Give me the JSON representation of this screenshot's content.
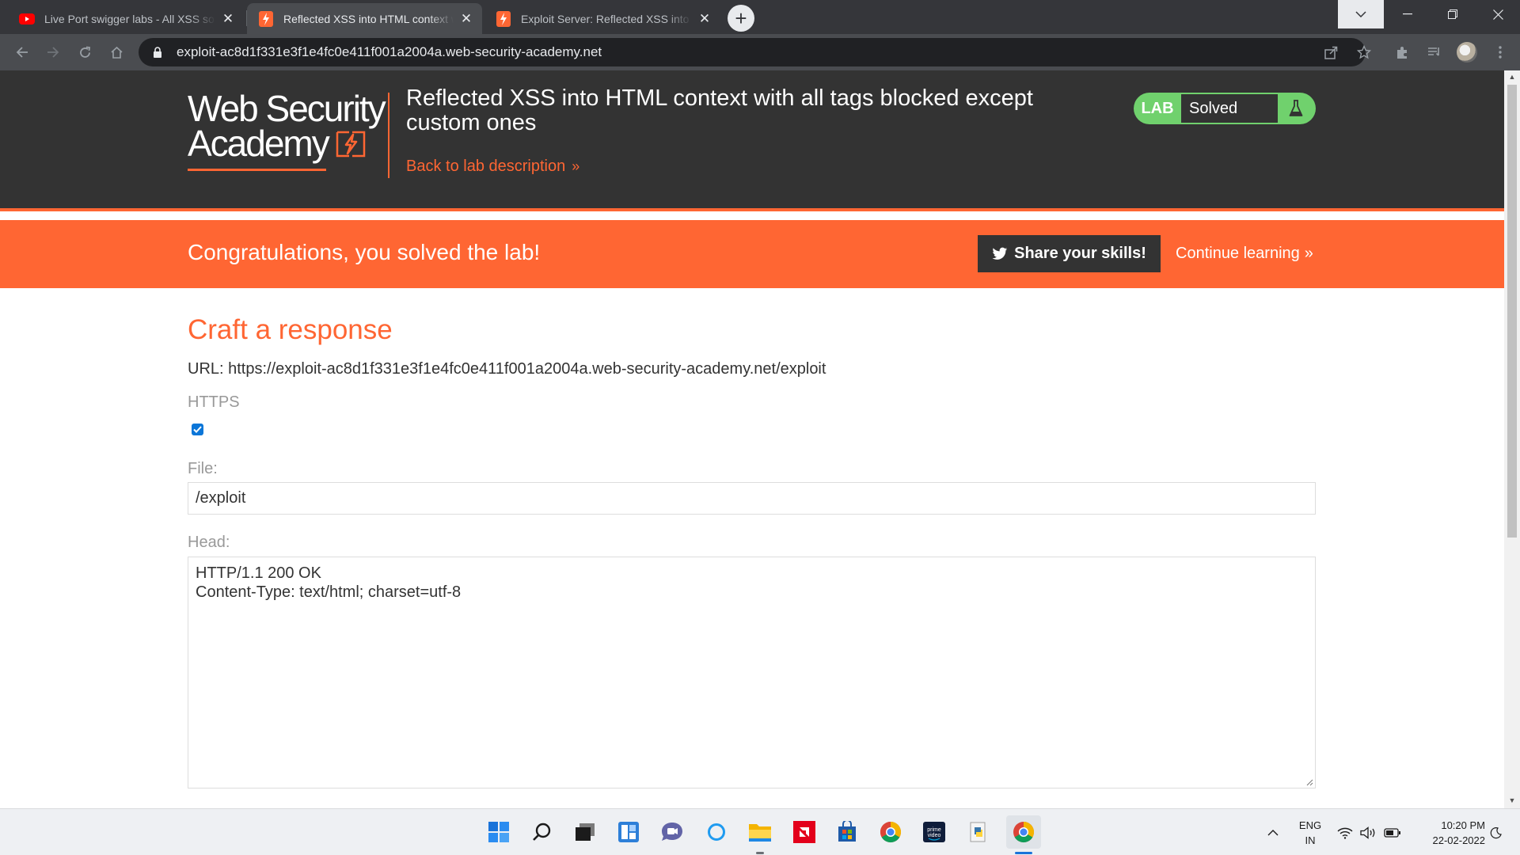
{
  "browser": {
    "tabs": [
      {
        "title": "Live Port swigger labs - All XSS solutions",
        "favicon": "youtube-icon",
        "active": false
      },
      {
        "title": "Reflected XSS into HTML context with all tags blocked except custom ones",
        "favicon": "portswigger-icon",
        "active": true
      },
      {
        "title": "Exploit Server: Reflected XSS into HTML context",
        "favicon": "portswigger-icon",
        "active": false
      }
    ],
    "new_tab": "+",
    "address": "exploit-ac8d1f331e3f1e4fc0e411f001a2004a.web-security-academy.net"
  },
  "header": {
    "logo_line1": "Web Security",
    "logo_line2": "Academy",
    "lab_title": "Reflected XSS into HTML context with all tags blocked except custom ones",
    "back_link": "Back to lab description",
    "back_chevrons": "»",
    "lab_badge": "LAB",
    "lab_status": "Solved"
  },
  "banner": {
    "message": "Congratulations, you solved the lab!",
    "share_label": "Share your skills!",
    "continue_label": "Continue learning",
    "continue_chevrons": "»"
  },
  "form": {
    "title": "Craft a response",
    "url_line": "URL: https://exploit-ac8d1f331e3f1e4fc0e411f001a2004a.web-security-academy.net/exploit",
    "https_label": "HTTPS",
    "https_checked": true,
    "file_label": "File:",
    "file_value": "/exploit",
    "head_label": "Head:",
    "head_line1": "HTTP/1.1 200 OK",
    "head_line2": "Content-Type: text/html; charset=utf-8"
  },
  "taskbar": {
    "apps": [
      "start-icon",
      "search-icon",
      "task-view-icon",
      "widgets-icon",
      "chat-icon",
      "cortana-icon",
      "file-explorer-icon",
      "amd-icon",
      "store-icon",
      "chrome-icon",
      "prime-video-icon",
      "python-icon",
      "chrome-icon"
    ],
    "lang_top": "ENG",
    "lang_bottom": "IN",
    "time": "10:20 PM",
    "date": "22-02-2022"
  },
  "colors": {
    "accent": "#ff6633",
    "header_bg": "#333333",
    "solved_green": "#70d16d"
  }
}
